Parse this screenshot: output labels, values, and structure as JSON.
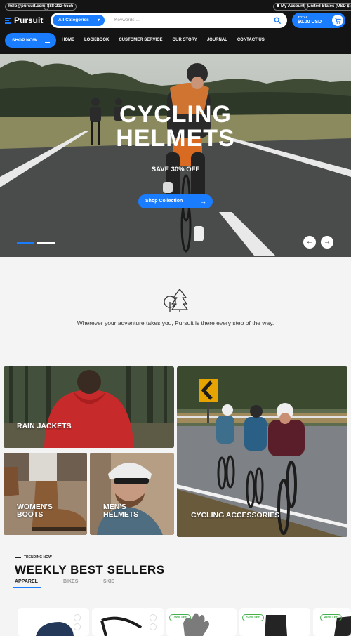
{
  "topbar": {
    "email": "help@pursuit.com",
    "phone": "888-212-5555",
    "account": "My Account",
    "currency": "United States (USD $)"
  },
  "header": {
    "logo": "Pursuit",
    "categories_label": "All Categories",
    "search_placeholder": "Keywords ...",
    "cart_total_label": "TOTAL",
    "cart_total_value": "$0.00 USD"
  },
  "nav": {
    "shop_now": "SHOP NOW",
    "items": [
      "HOME",
      "LOOKBOOK",
      "CUSTOMER SERVICE",
      "OUR STORY",
      "JOURNAL",
      "CONTACT US"
    ]
  },
  "hero": {
    "title_line1": "CYCLING",
    "title_line2": "HELMETS",
    "subtitle": "SAVE 30% OFF",
    "cta": "Shop Collection"
  },
  "intro": {
    "icon": "trees-icon",
    "message": "Wherever your adventure takes you, Pursuit is there every step of the way."
  },
  "categories": {
    "rain_jackets": "RAIN JACKETS",
    "cycling_accessories": "CYCLING ACCESSORIES",
    "womens_boots": "WOMEN'S BOOTS",
    "mens_helmets": "MEN'S HELMETS"
  },
  "trending": {
    "eyebrow": "TRENDING NOW",
    "title": "WEEKLY BEST SELLERS",
    "tabs": [
      "APPAREL",
      "BIKES",
      "SKIS"
    ],
    "badges": [
      "39% Off",
      "50% Off",
      "40% Off"
    ]
  },
  "colors": {
    "accent": "#1a7cff",
    "header_bg": "#141414",
    "badge": "#46b04a"
  }
}
